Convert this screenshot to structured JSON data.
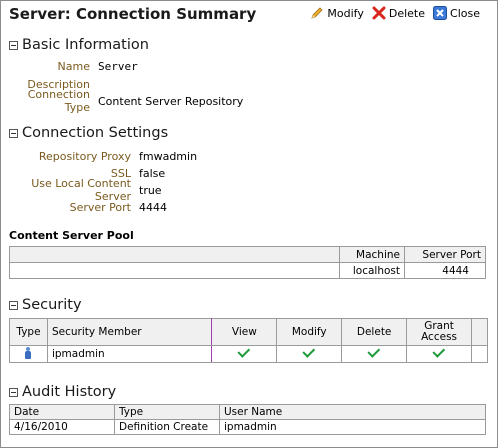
{
  "header": {
    "title": "Server: Connection Summary",
    "modify_label": "Modify",
    "delete_label": "Delete",
    "close_label": "Close"
  },
  "basic": {
    "heading": "Basic Information",
    "name_label": "Name",
    "name_value": "Server",
    "description_label": "Description",
    "description_value": "",
    "conn_type_label": "Connection Type",
    "conn_type_value": "Content Server Repository"
  },
  "connection": {
    "heading": "Connection Settings",
    "proxy_label": "Repository Proxy",
    "proxy_value": "fmwadmin",
    "ssl_label": "SSL",
    "ssl_value": "false",
    "local_label": "Use Local Content Server",
    "local_value": "true",
    "port_label": "Server Port",
    "port_value": "4444"
  },
  "pool": {
    "heading": "Content Server Pool",
    "columns": [
      "Machine",
      "Server Port"
    ],
    "rows": [
      [
        "localhost",
        "4444"
      ]
    ]
  },
  "security": {
    "heading": "Security",
    "columns": [
      "Type",
      "Security Member",
      "View",
      "Modify",
      "Delete",
      "Grant Access"
    ],
    "rows": [
      {
        "type_icon": "user-icon",
        "member": "ipmadmin",
        "view": true,
        "modify": true,
        "delete": true,
        "grant": true
      }
    ]
  },
  "audit": {
    "heading": "Audit History",
    "columns": [
      "Date",
      "Type",
      "User Name"
    ],
    "rows": [
      [
        "4/16/2010",
        "Definition Create",
        "ipmadmin"
      ]
    ]
  },
  "colors": {
    "label": "#7a5a1e",
    "check": "#1e9a3b",
    "delete_x": "#d9261c",
    "close_x": "#2f6fd0",
    "divider": "#9b3fb0"
  }
}
